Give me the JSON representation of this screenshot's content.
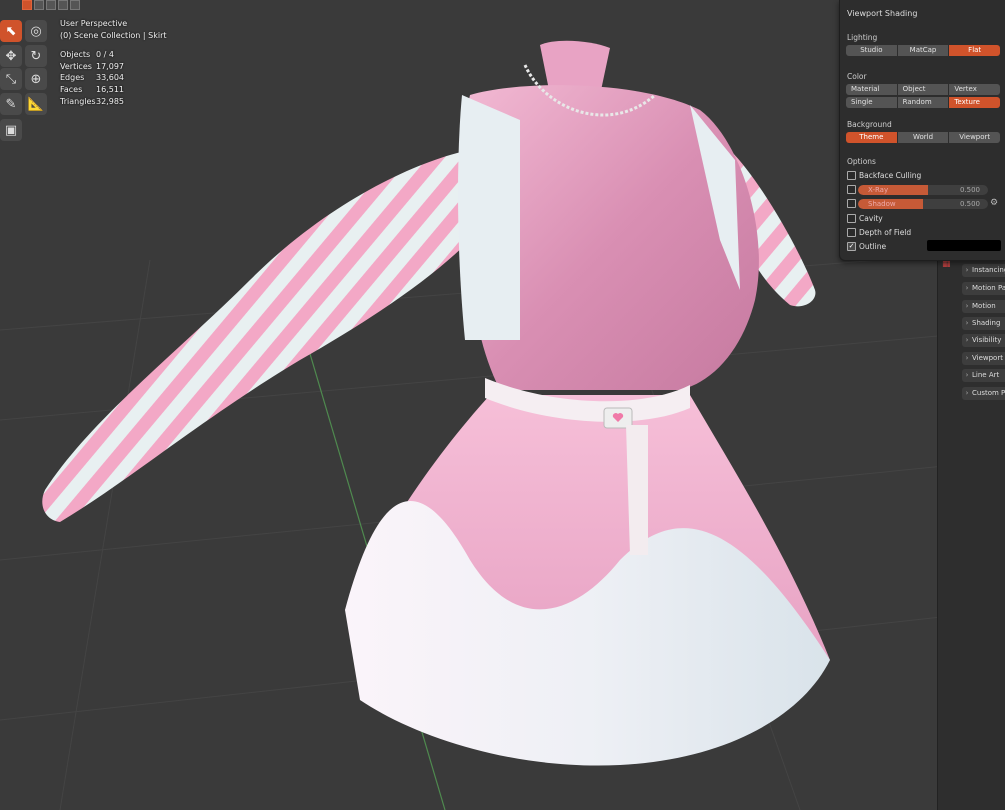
{
  "viewport": {
    "view_name": "User Perspective",
    "collection": "(0) Scene Collection | Skirt"
  },
  "stats": [
    {
      "label": "Objects",
      "value": "0 / 4"
    },
    {
      "label": "Vertices",
      "value": "17,097"
    },
    {
      "label": "Edges",
      "value": "33,604"
    },
    {
      "label": "Faces",
      "value": "16,511"
    },
    {
      "label": "Triangles",
      "value": "32,985"
    }
  ],
  "shading": {
    "title": "Viewport Shading",
    "lighting_label": "Lighting",
    "lighting": [
      "Studio",
      "MatCap",
      "Flat"
    ],
    "color_label": "Color",
    "color_row1": [
      "Material",
      "Object",
      "Vertex"
    ],
    "color_row2": [
      "Single",
      "Random",
      "Texture"
    ],
    "background_label": "Background",
    "background": [
      "Theme",
      "World",
      "Viewport"
    ],
    "options_label": "Options",
    "backface_culling": "Backface Culling",
    "xray_label": "X-Ray",
    "xray_value": "0.500",
    "shadow_label": "Shadow",
    "shadow_value": "0.500",
    "cavity": "Cavity",
    "depth_of_field": "Depth of Field",
    "outline": "Outline",
    "outline_color": "#000000",
    "accent_color": "#d0532b"
  },
  "properties": [
    "Instancing",
    "Motion Paths",
    "Motion",
    "Shading",
    "Visibility",
    "Viewport",
    "Line Art",
    "Custom P"
  ]
}
